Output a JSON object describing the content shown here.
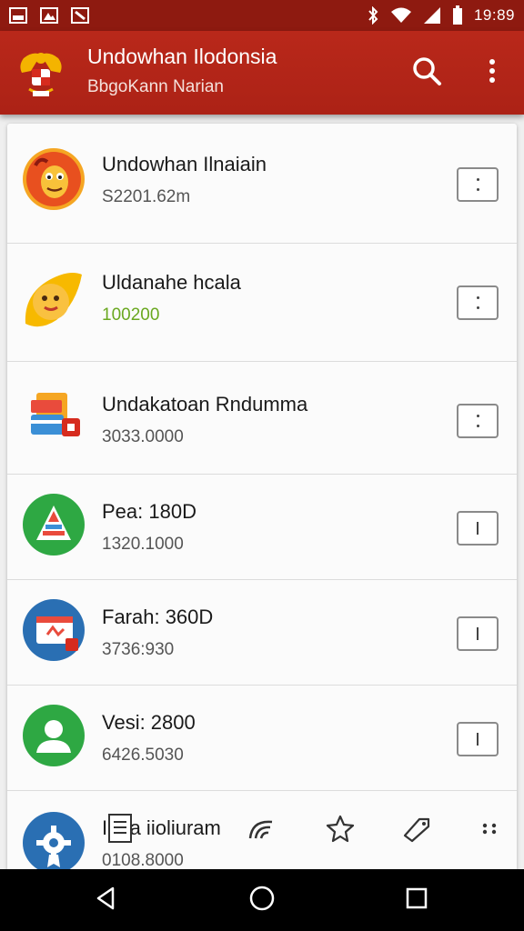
{
  "status_bar": {
    "time": "19:89",
    "left_icons": [
      "image-icon",
      "photo-icon",
      "crop-icon"
    ],
    "right_icons": [
      "bluetooth-icon",
      "wifi-icon",
      "signal-icon",
      "battery-icon"
    ]
  },
  "app_bar": {
    "title": "Undowhan Ilodonsia",
    "subtitle": "BbgoKann Narian",
    "logo_icon": "garuda-emblem-icon",
    "actions": [
      "search-icon",
      "more-vert-icon"
    ]
  },
  "list": {
    "items": [
      {
        "title": "Undowhan Ilnaiain",
        "subtitle": "S2201.62m",
        "icon": "cartoon-character-icon",
        "button": "more-dots-icon"
      },
      {
        "title": "Uldanahe hcala",
        "subtitle": "100200",
        "icon": "smiley-face-icon",
        "button": "more-dots-icon",
        "subtitle_color": "#6aa820"
      },
      {
        "title": "Undakatoan Rndumma",
        "subtitle": "3033.0000",
        "icon": "cards-wallet-icon",
        "button": "more-dots-icon"
      },
      {
        "title": "Pea: 180D",
        "subtitle": "1320.1000",
        "icon": "pyramid-chart-icon",
        "button": "single-bar-icon"
      },
      {
        "title": "Farah: 360D",
        "subtitle": "3736:930",
        "icon": "calendar-app-icon",
        "button": "single-bar-icon"
      },
      {
        "title": "Vesi: 2800",
        "subtitle": "6426.5030",
        "icon": "person-avatar-icon",
        "button": "single-bar-icon"
      },
      {
        "title": "Iena iioliuram",
        "subtitle": "0108.8000",
        "icon": "gear-badge-icon",
        "button": null
      }
    ]
  },
  "bottom_toolbar": {
    "items": [
      "document-icon",
      "rainbow-icon",
      "star-icon",
      "tag-icon",
      "more-horiz-icon"
    ]
  },
  "nav_bar": {
    "items": [
      "back-icon",
      "home-icon",
      "recents-icon"
    ]
  },
  "colors": {
    "app_bar": "#b9281a",
    "status_bar": "#8e1a10",
    "accent_green": "#6aa820"
  }
}
